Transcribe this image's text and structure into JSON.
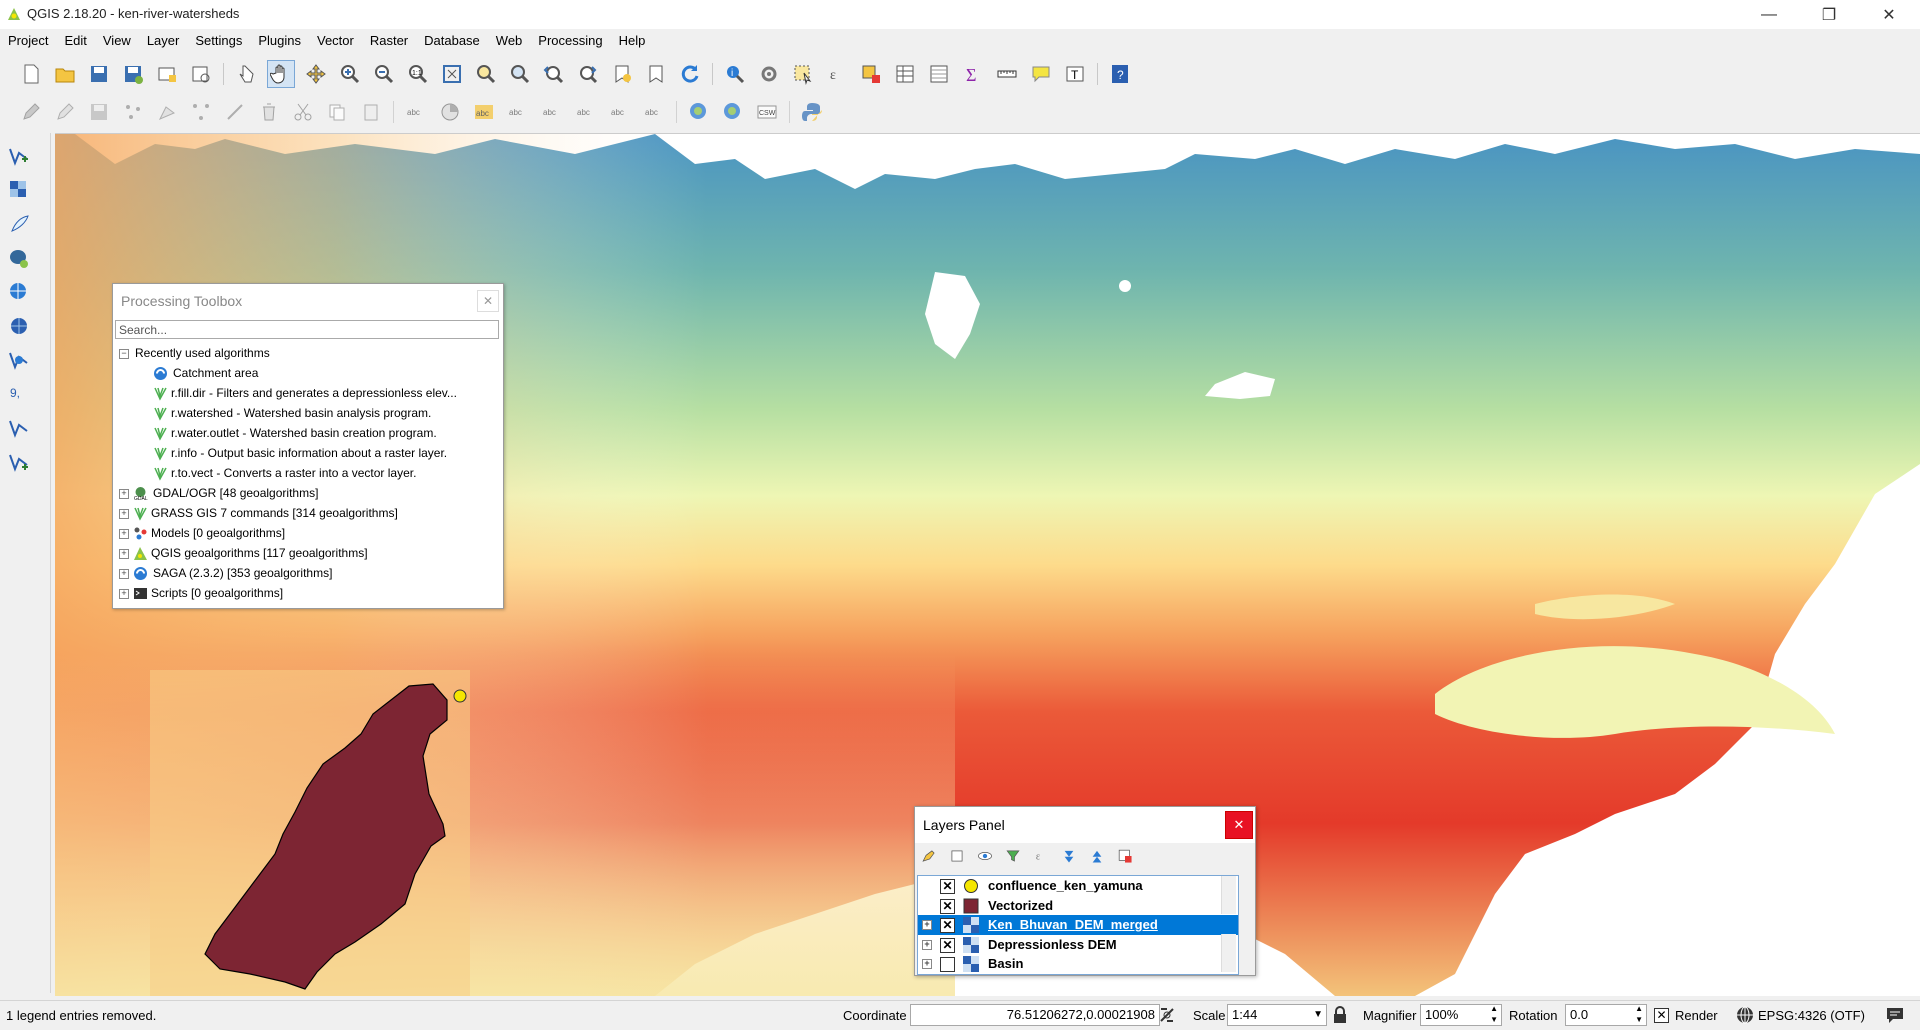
{
  "window": {
    "title": "QGIS 2.18.20 - ken-river-watersheds",
    "minimize": "—",
    "restore": "❐",
    "close": "✕"
  },
  "menu": [
    "Project",
    "Edit",
    "View",
    "Layer",
    "Settings",
    "Plugins",
    "Vector",
    "Raster",
    "Database",
    "Web",
    "Processing",
    "Help"
  ],
  "processing_toolbox": {
    "title": "Processing Toolbox",
    "search_placeholder": "Search...",
    "recent_label": "Recently used algorithms",
    "recent": [
      "Catchment area",
      "r.fill.dir - Filters and generates a depressionless elev...",
      "r.watershed - Watershed basin analysis program.",
      "r.water.outlet - Watershed basin creation program.",
      "r.info - Output basic information about a raster layer.",
      "r.to.vect - Converts a raster into a vector layer."
    ],
    "providers": [
      "GDAL/OGR [48 geoalgorithms]",
      "GRASS GIS 7 commands [314 geoalgorithms]",
      "Models [0 geoalgorithms]",
      "QGIS geoalgorithms [117 geoalgorithms]",
      "SAGA (2.3.2) [353 geoalgorithms]",
      "Scripts [0 geoalgorithms]"
    ]
  },
  "layers_panel": {
    "title": "Layers Panel",
    "layers": [
      {
        "name": "confluence_ken_yamuna",
        "checked": true,
        "selected": false
      },
      {
        "name": "Vectorized",
        "checked": true,
        "selected": false
      },
      {
        "name": "Ken_Bhuvan_DEM_merged",
        "checked": true,
        "selected": true
      },
      {
        "name": "Depressionless DEM",
        "checked": true,
        "selected": false
      },
      {
        "name": "Basin",
        "checked": false,
        "selected": false
      }
    ]
  },
  "status": {
    "message": "1 legend entries removed.",
    "coordinate_label": "Coordinate",
    "coordinate_value": "76.51206272,0.00021908",
    "scale_label": "Scale",
    "scale_value": "1:44",
    "magnifier_label": "Magnifier",
    "magnifier_value": "100%",
    "rotation_label": "Rotation",
    "rotation_value": "0.0",
    "render_label": "Render",
    "crs": "EPSG:4326 (OTF)"
  },
  "colors": {
    "selection": "#0078d7",
    "basin_fill": "#7d2533",
    "confluence_point": "#f5e600",
    "dem_low": "#d7191c",
    "dem_high": "#2b83ba"
  }
}
